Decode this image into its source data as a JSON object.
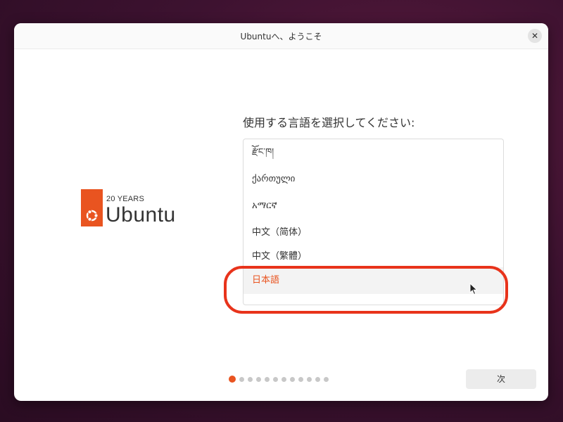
{
  "window": {
    "title": "Ubuntuへ、ようこそ",
    "close_symbol": "✕"
  },
  "logo": {
    "years": "20 YEARS",
    "name": "Ubuntu",
    "brand_color": "#e95420"
  },
  "prompt": "使用する言語を選択してください:",
  "languages": [
    "རྫོང་ཁ།",
    "ქართული",
    "አማርኛ",
    "中文（简体）",
    "中文（繁體）",
    "日本語"
  ],
  "selected_language": "日本語",
  "pagination": {
    "total": 12,
    "current": 1
  },
  "next_button": "次",
  "colors": {
    "accent": "#e95420",
    "highlight_ring": "#e8331b"
  }
}
